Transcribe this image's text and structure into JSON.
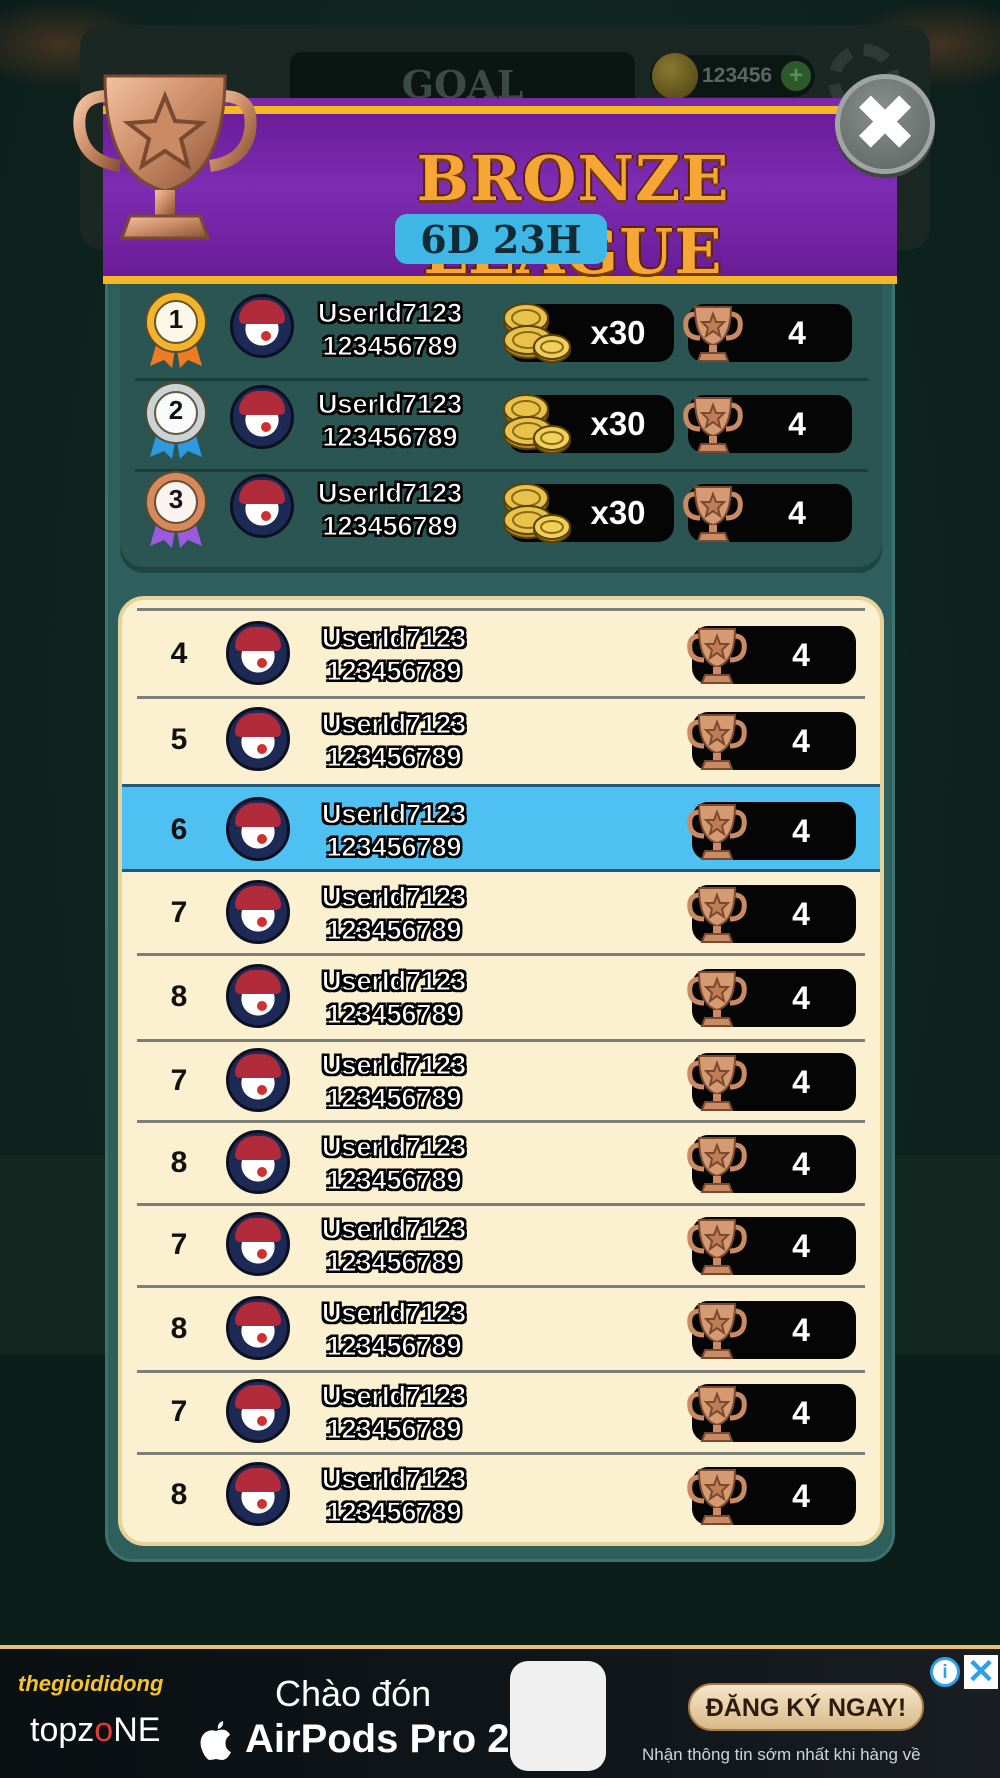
{
  "header": {
    "goal_label": "GOAL",
    "coin_balance": "123456",
    "plus_label": "+"
  },
  "league": {
    "title": "BRONZE LEAGUE",
    "time_left": "6D 23H",
    "close_label": "✖"
  },
  "top3": [
    {
      "rank": "1",
      "user": "UserId7123",
      "id": "123456789",
      "reward": "x30",
      "trophies": "4",
      "medal_color": "#f2b42a",
      "ribbon": "#f07b24"
    },
    {
      "rank": "2",
      "user": "UserId7123",
      "id": "123456789",
      "reward": "x30",
      "trophies": "4",
      "medal_color": "#c9d3d8",
      "ribbon": "#2d9ae0"
    },
    {
      "rank": "3",
      "user": "UserId7123",
      "id": "123456789",
      "reward": "x30",
      "trophies": "4",
      "medal_color": "#d7895e",
      "ribbon": "#9b5be0"
    }
  ],
  "list": [
    {
      "rank": "4",
      "user": "UserId7123",
      "id": "123456789",
      "trophies": "4"
    },
    {
      "rank": "5",
      "user": "UserId7123",
      "id": "123456789",
      "trophies": "4"
    },
    {
      "rank": "6",
      "user": "UserId7123",
      "id": "123456789",
      "trophies": "4",
      "highlighted": true
    },
    {
      "rank": "7",
      "user": "UserId7123",
      "id": "123456789",
      "trophies": "4"
    },
    {
      "rank": "8",
      "user": "UserId7123",
      "id": "123456789",
      "trophies": "4"
    },
    {
      "rank": "7",
      "user": "UserId7123",
      "id": "123456789",
      "trophies": "4"
    },
    {
      "rank": "8",
      "user": "UserId7123",
      "id": "123456789",
      "trophies": "4"
    },
    {
      "rank": "7",
      "user": "UserId7123",
      "id": "123456789",
      "trophies": "4"
    },
    {
      "rank": "8",
      "user": "UserId7123",
      "id": "123456789",
      "trophies": "4"
    },
    {
      "rank": "7",
      "user": "UserId7123",
      "id": "123456789",
      "trophies": "4"
    },
    {
      "rank": "8",
      "user": "UserId7123",
      "id": "123456789",
      "trophies": "4"
    }
  ],
  "ad": {
    "brand": "thegioididong",
    "topzone_pre": "topz",
    "topzone_o": "o",
    "topzone_post": "NE",
    "line1": "Chào đón",
    "line2": "AirPods Pro 2",
    "cta": "ĐĂNG KÝ NGAY!",
    "sub": "Nhận thông tin sớm nhất khi hàng về",
    "info_label": "i",
    "close_label": "✕"
  },
  "colors": {
    "banner_purple": "#7e2cb2",
    "banner_gold": "#f5b627",
    "list_bg": "#fbf0cf",
    "highlight_blue": "#4ec0f1",
    "panel_teal": "#2f5f5c"
  }
}
